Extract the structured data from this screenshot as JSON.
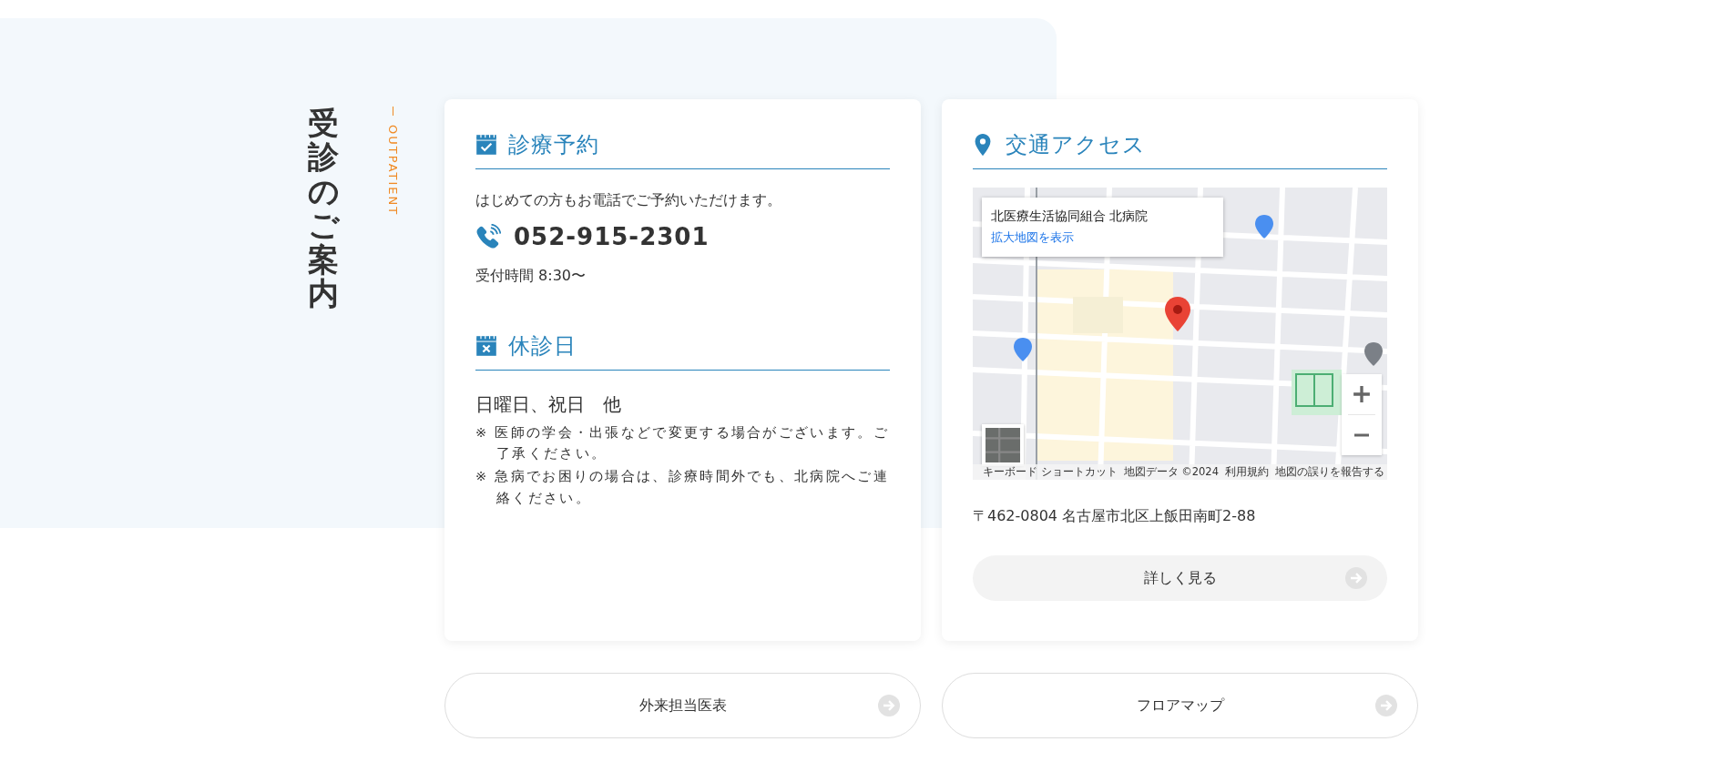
{
  "section": {
    "title": "受診のご案内",
    "subtitle": "OUTPATIENT"
  },
  "reservation": {
    "heading": "診療予約",
    "intro": "はじめての方もお電話でご予約いただけます。",
    "phone": "052-915-2301",
    "hours": "受付時間 8:30〜"
  },
  "closed_days": {
    "heading": "休診日",
    "days": "日曜日、祝日　他",
    "notes": [
      "※ 医師の学会・出張などで変更する場合がございます。ご了承ください。",
      "※ 急病でお困りの場合は、診療時間外でも、北病院へご連絡ください。"
    ]
  },
  "access": {
    "heading": "交通アクセス",
    "map": {
      "kind": "picture",
      "place_name": "北医療生活協同組合 北病院",
      "larger_map_link": "拡大地図を表示",
      "footer_links": [
        "キーボード ショートカット",
        "地図データ ©2024",
        "利用規約",
        "地図の誤りを報告する"
      ]
    },
    "address": "〒462-0804 名古屋市北区上飯田南町2-88",
    "button": "詳しく見る"
  },
  "buttons": [
    "外来担当医表",
    "フロアマップ"
  ]
}
